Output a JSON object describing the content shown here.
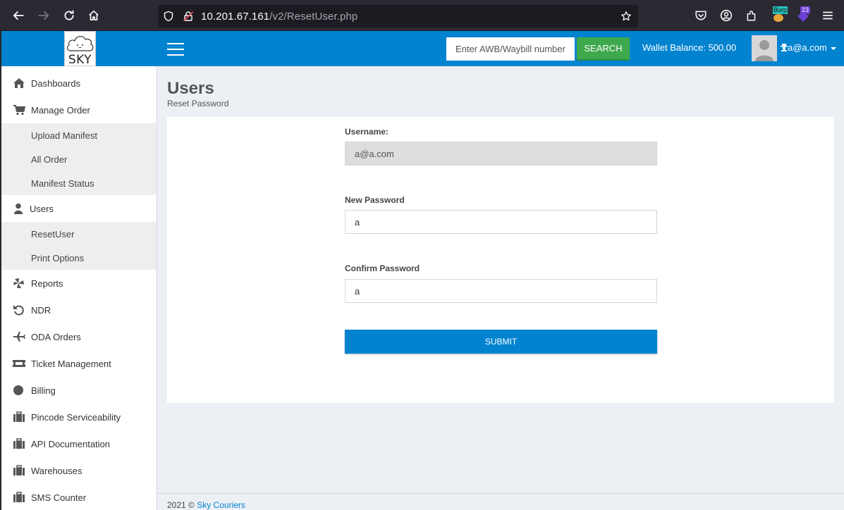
{
  "browser": {
    "url_host": "10.201.67.161",
    "url_path": "/v2/ResetUser.php",
    "badge_count": "23",
    "ext_label": "Burp"
  },
  "header": {
    "logo_text": "SKY",
    "awb_placeholder": "Enter AWB/Waybill number",
    "search_label": "SEARCH",
    "wallet_label": "Wallet Balance: 500.00",
    "user_email": "a@a.com"
  },
  "sidebar": {
    "items": [
      {
        "label": "Dashboards",
        "icon": "home-icon"
      },
      {
        "label": "Manage Order",
        "icon": "cart-icon"
      },
      {
        "label": "Upload Manifest"
      },
      {
        "label": "All Order"
      },
      {
        "label": "Manifest Status"
      },
      {
        "label": "Users",
        "icon": "user-icon"
      },
      {
        "label": "ResetUser"
      },
      {
        "label": "Print Options"
      },
      {
        "label": "Reports",
        "icon": "pinwheel-icon"
      },
      {
        "label": "NDR",
        "icon": "undo-icon"
      },
      {
        "label": "ODA Orders",
        "icon": "plane-icon"
      },
      {
        "label": "Ticket Management",
        "icon": "ticket-icon"
      },
      {
        "label": "Billing",
        "icon": "circle-icon"
      },
      {
        "label": "Pincode Serviceability",
        "icon": "briefcase-icon"
      },
      {
        "label": "API Documentation",
        "icon": "briefcase-icon"
      },
      {
        "label": "Warehouses",
        "icon": "briefcase-icon"
      },
      {
        "label": "SMS Counter",
        "icon": "briefcase-icon"
      }
    ]
  },
  "main": {
    "title": "Users",
    "subtitle": "Reset Password",
    "username_label": "Username:",
    "username_value": "a@a.com",
    "new_password_label": "New Password",
    "new_password_value": "a",
    "confirm_password_label": "Confirm Password",
    "confirm_password_value": "a",
    "submit_label": "SUBMIT"
  },
  "footer": {
    "copyright": "2021 ©",
    "company": "Sky Couriers"
  },
  "colors": {
    "primary": "#0283d0",
    "search_green": "#3ea84c",
    "content_bg": "#ecf0f5"
  }
}
